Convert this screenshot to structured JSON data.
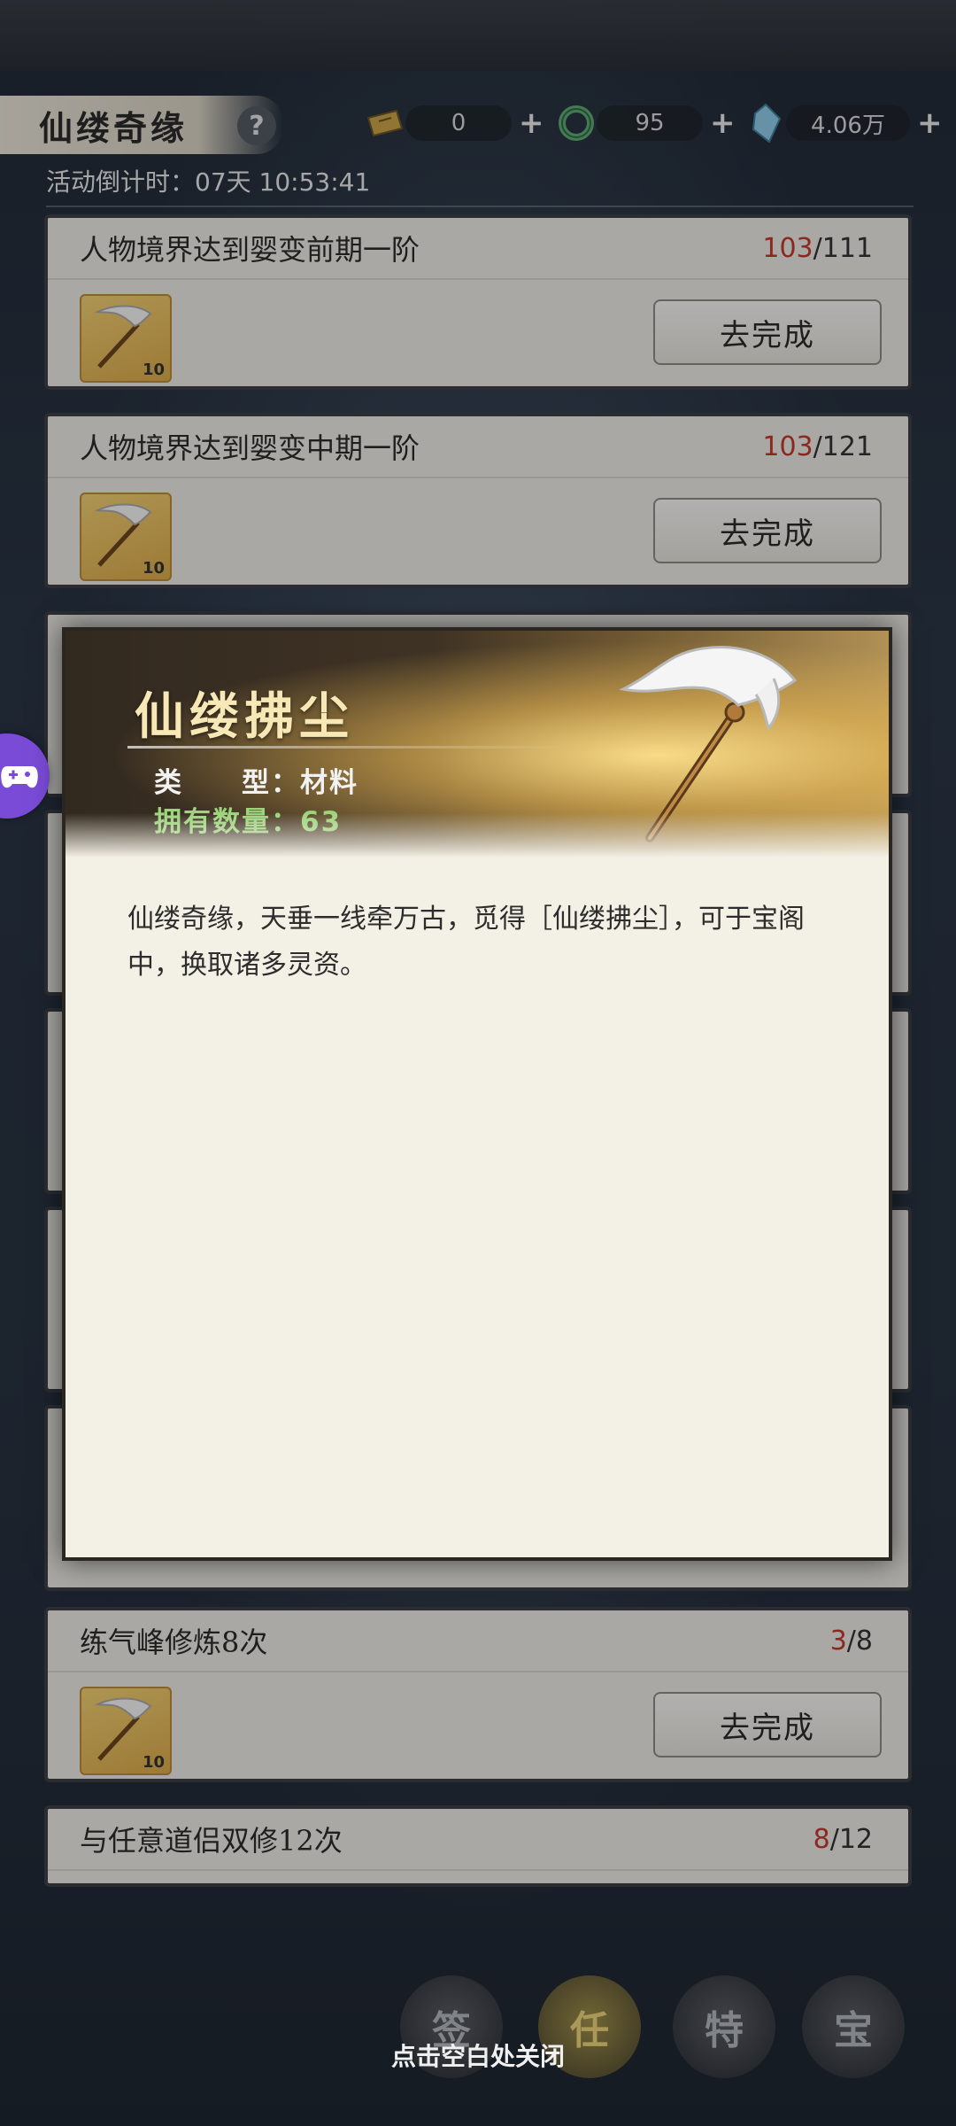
{
  "header": {
    "title": "仙缕奇缘",
    "help_label": "?",
    "currencies": [
      {
        "icon": "ticket-icon",
        "value": "0"
      },
      {
        "icon": "jade-ring-icon",
        "value": "95"
      },
      {
        "icon": "spirit-stone-icon",
        "value": "4.06万"
      }
    ],
    "plus_label": "+"
  },
  "countdown": "活动倒计时：07天 10:53:41",
  "tasks": [
    {
      "name": "人物境界达到婴变前期一阶",
      "current": "103",
      "total": "/111",
      "reward_qty": "10",
      "button": "去完成"
    },
    {
      "name": "人物境界达到婴变中期一阶",
      "current": "103",
      "total": "/121",
      "reward_qty": "10",
      "button": "去完成"
    },
    {
      "name": "练气峰修炼8次",
      "current": "3",
      "total": "/8",
      "reward_qty": "10",
      "button": "去完成"
    },
    {
      "name": "与任意道侣双修12次",
      "current": "8",
      "total": "/12"
    }
  ],
  "popup": {
    "item_name": "仙缕拂尘",
    "type_line": "类　　型：材料",
    "count_line": "拥有数量：63",
    "description": "仙缕奇缘，天垂一线牵万古，觅得［仙缕拂尘］，可于宝阁中，换取诸多灵资。"
  },
  "close_hint": "点击空白处关闭",
  "bottom_nav": [
    {
      "label": "签",
      "active": false
    },
    {
      "label": "任",
      "active": true
    },
    {
      "label": "特",
      "active": false
    },
    {
      "label": "宝",
      "active": false
    }
  ],
  "colors": {
    "progress_current": "#c0392b",
    "owned_count": "#9bd47a",
    "item_name": "#f7e8b6"
  }
}
